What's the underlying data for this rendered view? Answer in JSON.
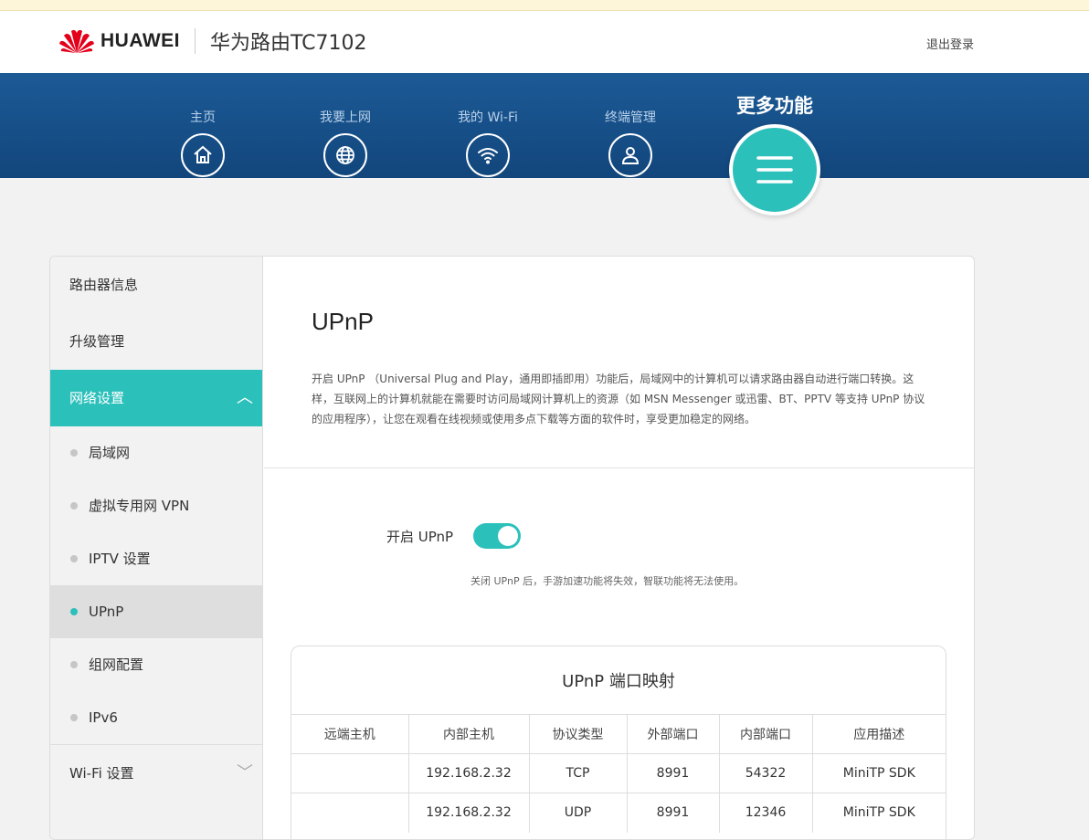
{
  "header": {
    "brand": "HUAWEI",
    "product": "华为路由TC7102",
    "logout": "退出登录"
  },
  "nav": {
    "items": [
      {
        "label": "主页",
        "icon": "home-icon"
      },
      {
        "label": "我要上网",
        "icon": "globe-icon"
      },
      {
        "label": "我的 Wi-Fi",
        "icon": "wifi-icon"
      },
      {
        "label": "终端管理",
        "icon": "user-icon"
      }
    ],
    "more": {
      "label": "更多功能",
      "icon": "menu-icon"
    }
  },
  "sidebar": {
    "items": [
      {
        "label": "路由器信息"
      },
      {
        "label": "升级管理"
      },
      {
        "label": "网络设置",
        "active": true
      }
    ],
    "sub_items": [
      {
        "label": "局域网"
      },
      {
        "label": "虚拟专用网 VPN"
      },
      {
        "label": "IPTV 设置"
      },
      {
        "label": "UPnP",
        "selected": true
      },
      {
        "label": "组网配置"
      },
      {
        "label": "IPv6"
      }
    ],
    "wifi": {
      "label": "Wi-Fi 设置"
    }
  },
  "content": {
    "title": "UPnP",
    "description": "开启 UPnP （Universal Plug and Play，通用即插即用）功能后，局域网中的计算机可以请求路由器自动进行端口转换。这样，互联网上的计算机就能在需要时访问局域网计算机上的资源（如 MSN Messenger 或迅雷、BT、PPTV 等支持 UPnP 协议的应用程序），让您在观看在线视频或使用多点下载等方面的软件时，享受更加稳定的网络。",
    "toggle_label": "开启 UPnP",
    "toggle_on": true,
    "toggle_hint": "关闭 UPnP 后，手游加速功能将失效，智联功能将无法使用。"
  },
  "port_map": {
    "title": "UPnP 端口映射",
    "columns": [
      "远端主机",
      "内部主机",
      "协议类型",
      "外部端口",
      "内部端口",
      "应用描述"
    ],
    "rows": [
      [
        "",
        "192.168.2.32",
        "TCP",
        "8991",
        "54322",
        "MiniTP SDK"
      ],
      [
        "",
        "192.168.2.32",
        "UDP",
        "8991",
        "12346",
        "MiniTP SDK"
      ]
    ]
  },
  "colors": {
    "accent": "#2cc0bb",
    "nav_bg": "#17508a"
  }
}
